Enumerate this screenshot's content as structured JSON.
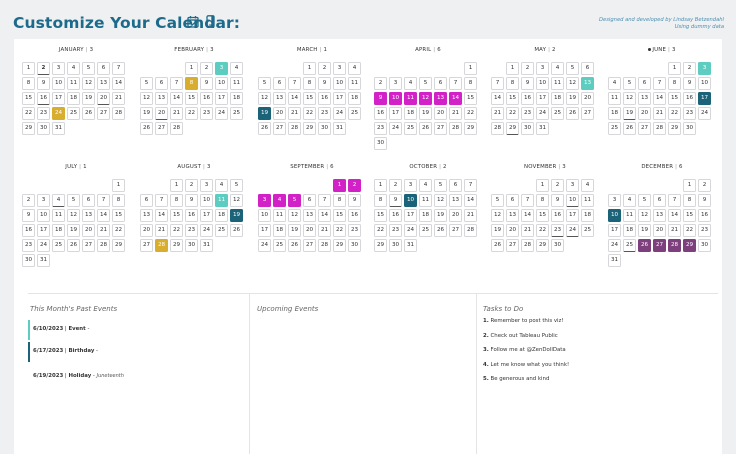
{
  "header": {
    "title": "Customize Your Calendar:",
    "icons": [
      "calendar-check-icon",
      "mobile-phone-icon"
    ],
    "credit_line1": "Designed and developed by Lindsay Betzendahl",
    "credit_line2": "Using dummy data"
  },
  "colors": {
    "header_blue": "#1e6a8a",
    "Event": "#5ccdc0",
    "Birthday": "#1b6378",
    "Holiday": "#d9ad2e",
    "Travel": "#d321c8",
    "Vacation": "#7e3f7d"
  },
  "months": [
    {
      "name": "JANUARY",
      "count": "3",
      "sep": "|",
      "firstWeekday": 0,
      "days": 31,
      "events": {
        "2": "today",
        "16": "past",
        "20": "past",
        "24": "yellow"
      }
    },
    {
      "name": "FEBRUARY",
      "count": "3",
      "sep": "|",
      "firstWeekday": 3,
      "days": 28,
      "events": {
        "3": "teal",
        "8": "yellow",
        "20": "past"
      }
    },
    {
      "name": "MARCH",
      "count": "1",
      "sep": "|",
      "firstWeekday": 3,
      "days": 31,
      "events": {
        "19": "navy"
      }
    },
    {
      "name": "APRIL",
      "count": "6",
      "sep": "|",
      "firstWeekday": 6,
      "days": 30,
      "events": {
        "9": "magenta",
        "10": "magenta",
        "11": "magenta",
        "12": "magenta",
        "13": "magenta",
        "14": "magenta"
      }
    },
    {
      "name": "MAY",
      "count": "2",
      "sep": "|",
      "firstWeekday": 1,
      "days": 31,
      "events": {
        "13": "teal",
        "29": "past"
      }
    },
    {
      "name": "JUNE",
      "count": "3",
      "sep": "|",
      "firstWeekday": 4,
      "days": 30,
      "current": true,
      "events": {
        "3": "teal",
        "17": "navy",
        "19": "past"
      }
    },
    {
      "name": "JULY",
      "count": "1",
      "sep": "|",
      "firstWeekday": 6,
      "days": 31,
      "events": {
        "4": "past"
      }
    },
    {
      "name": "AUGUST",
      "count": "3",
      "sep": "|",
      "firstWeekday": 2,
      "days": 31,
      "events": {
        "11": "teal",
        "19": "navy",
        "28": "yellow"
      }
    },
    {
      "name": "SEPTEMBER",
      "count": "6",
      "sep": "|",
      "firstWeekday": 5,
      "days": 30,
      "events": {
        "1": "magenta",
        "2": "magenta",
        "3": "magenta",
        "4": "magenta",
        "5": "magenta"
      }
    },
    {
      "name": "OCTOBER",
      "count": "2",
      "sep": "|",
      "firstWeekday": 0,
      "days": 31,
      "events": {
        "9": "past",
        "10": "navy"
      }
    },
    {
      "name": "NOVEMBER",
      "count": "3",
      "sep": "|",
      "firstWeekday": 3,
      "days": 30,
      "events": {
        "10": "past",
        "23": "past",
        "24": "past"
      }
    },
    {
      "name": "DECEMBER",
      "count": "6",
      "sep": "|",
      "firstWeekday": 5,
      "days": 31,
      "events": {
        "10": "navy",
        "25": "past",
        "26": "purple",
        "27": "purple",
        "28": "purple",
        "29": "purple"
      }
    }
  ],
  "past_events": {
    "title": "This Month's Past Events",
    "items": [
      {
        "date": "6/10/2023",
        "type": "Event",
        "note": "",
        "color": "#5ccdc0"
      },
      {
        "date": "6/17/2023",
        "type": "Birthday",
        "note": "",
        "color": "#1b6378"
      },
      {
        "date": "6/19/2023",
        "type": "Holiday",
        "note": "Juneteenth",
        "color": "#ffffff"
      }
    ]
  },
  "upcoming_events": {
    "title": "Upcoming Events"
  },
  "tasks": {
    "title": "Tasks to Do",
    "items": [
      {
        "num": "1.",
        "text": "Remember to post this viz!"
      },
      {
        "num": "2.",
        "text": "Check out Tableau Public"
      },
      {
        "num": "3.",
        "text": "Follow me at @ZenDollData"
      },
      {
        "num": "4.",
        "text": "Let me know what you think!"
      },
      {
        "num": "5.",
        "text": "Be generous and kind"
      }
    ]
  }
}
